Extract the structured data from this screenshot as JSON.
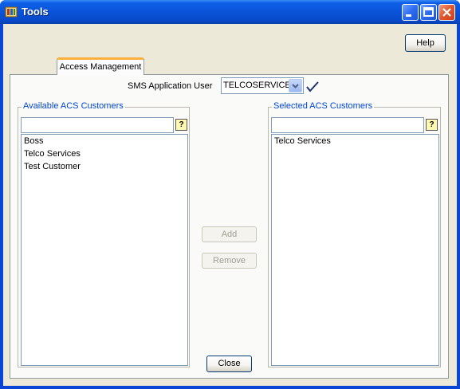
{
  "window": {
    "title": "Tools"
  },
  "toolbar": {
    "help_label": "Help",
    "close_label": "Close"
  },
  "tabs": [
    {
      "label": "Access Management",
      "active": true
    }
  ],
  "sms_user": {
    "label": "SMS Application User",
    "selected": "TELCOSERVICES"
  },
  "available": {
    "title": "Available ACS Customers",
    "filter_value": "",
    "items": [
      "Boss",
      "Telco Services",
      "Test Customer"
    ]
  },
  "selected": {
    "title": "Selected ACS Customers",
    "filter_value": "",
    "items": [
      "Telco Services"
    ]
  },
  "actions": {
    "add_label": "Add",
    "remove_label": "Remove"
  },
  "colors": {
    "titlebar": "#0a53d9",
    "group_title": "#0046d5",
    "tab_accent": "#f9b03f"
  }
}
